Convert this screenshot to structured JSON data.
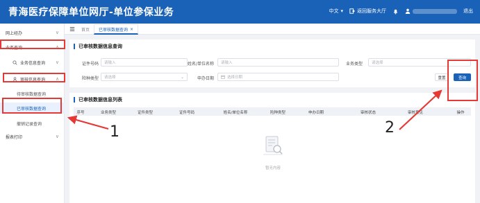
{
  "header": {
    "brand": "青海医疗保障单位网厅-单位参保业务",
    "lang": "中文",
    "lang_arrow": "▾",
    "back": "返回服务大厅",
    "logout": "退出"
  },
  "sidebar": {
    "items": [
      {
        "label": "网上经办",
        "chev": "∨"
      },
      {
        "label": "业务查询",
        "chev": "∨"
      },
      {
        "label": "业务信息查询",
        "chev": "∨"
      },
      {
        "label": "审核信息查询",
        "chev": "∨"
      },
      {
        "label": "待审核数据查询"
      },
      {
        "label": "已审核数据查询"
      },
      {
        "label": "撤销记录查询"
      },
      {
        "label": "报表打印",
        "chev": "∨"
      }
    ]
  },
  "tabs": {
    "home": "首页",
    "active": "已审核数据查询",
    "active_close": "×"
  },
  "search": {
    "title": "已审核数据信息查询",
    "fields": {
      "cert_no": {
        "label": "证件号码",
        "placeholder": "请输入"
      },
      "name": {
        "label": "姓名/单位名称",
        "placeholder": "请输入"
      },
      "biz_type": {
        "label": "业务类型",
        "placeholder": "请选择"
      },
      "insure_type": {
        "label": "险种类型",
        "placeholder": "请选择"
      },
      "apply_date": {
        "label": "申办日期",
        "placeholder": "选择日期"
      }
    },
    "reset": "重置",
    "query": "查询"
  },
  "results": {
    "title": "已审核数据信息列表",
    "columns": [
      "序号",
      "业务类型",
      "证件类型",
      "证件号码",
      "姓名/单位名称",
      "险种类型",
      "申办日期",
      "审核状态",
      "审核意见",
      "操作"
    ],
    "empty": "暂无内容"
  },
  "annotations": {
    "one": "1",
    "two": "2"
  },
  "colors": {
    "primary": "#1a62b8",
    "annotation": "#e53935"
  }
}
